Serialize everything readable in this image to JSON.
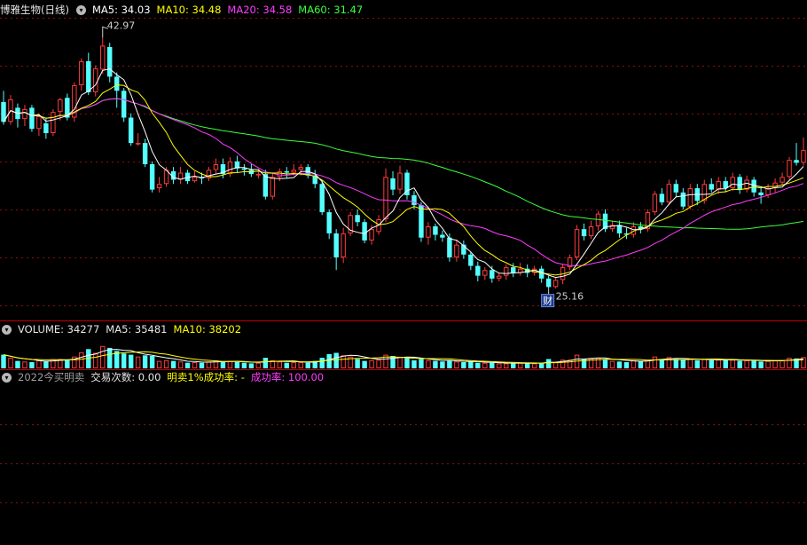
{
  "colors": {
    "background": "#000000",
    "up": "#ff3b3b",
    "down": "#54ffff",
    "ma5": "#ffffff",
    "ma10": "#ffff00",
    "ma20": "#ff3cff",
    "ma60": "#3cff3c",
    "grid": "#8a1010",
    "separator": "#c00000",
    "signal": "#ff2020",
    "header_text": "#e6e6e6",
    "header_label": "#9e9e9e"
  },
  "price_panel": {
    "stock_name": "博雅生物(日线)",
    "toggle_icon": "chevron-down-icon",
    "ma_labels": [
      {
        "key": "ma5",
        "text": "MA5: 34.03"
      },
      {
        "key": "ma10",
        "text": "MA10: 34.48"
      },
      {
        "key": "ma20",
        "text": "MA20: 34.58"
      },
      {
        "key": "ma60",
        "text": "MA60: 31.47"
      }
    ],
    "high_label": "42.97",
    "low_label": "25.16",
    "finance_badge": "财",
    "signal_marker": "$"
  },
  "volume_panel": {
    "toggle_icon": "chevron-down-icon",
    "labels": [
      {
        "key": "vol",
        "text": "VOLUME: 34277"
      },
      {
        "key": "ma5",
        "text": "MA5: 35481"
      },
      {
        "key": "ma10",
        "text": "MA10: 38202"
      }
    ]
  },
  "indicator_panel": {
    "toggle_icon": "chevron-down-icon",
    "labels": [
      {
        "key": "name",
        "text": "2022今买明卖"
      },
      {
        "key": "trades",
        "text": "交易次数: 0.00"
      },
      {
        "key": "rate1",
        "text": "明卖1%成功率: -"
      },
      {
        "key": "rate2",
        "text": "成功率: 100.00"
      }
    ]
  },
  "chart_data": {
    "type": "candlestick",
    "price_range": [
      23.5,
      44.5
    ],
    "high_value": 42.97,
    "low_value": 25.16,
    "candles": [
      [
        38.4,
        37.0,
        39.2,
        36.8
      ],
      [
        37.0,
        38.6,
        38.9,
        36.8
      ],
      [
        38.0,
        37.2,
        38.3,
        36.6
      ],
      [
        37.2,
        37.9,
        38.2,
        36.7
      ],
      [
        38.0,
        36.5,
        38.2,
        36.3
      ],
      [
        36.5,
        37.4,
        37.6,
        36.0
      ],
      [
        36.9,
        36.2,
        37.3,
        35.8
      ],
      [
        36.2,
        37.7,
        37.9,
        36.0
      ],
      [
        37.7,
        38.6,
        38.7,
        37.1
      ],
      [
        38.7,
        37.3,
        39.0,
        37.1
      ],
      [
        37.3,
        39.6,
        39.8,
        37.0
      ],
      [
        39.6,
        41.3,
        41.5,
        39.2
      ],
      [
        41.3,
        39.1,
        41.9,
        38.9
      ],
      [
        39.1,
        40.8,
        41.0,
        38.8
      ],
      [
        40.7,
        42.4,
        42.97,
        40.4
      ],
      [
        42.3,
        40.2,
        42.6,
        39.8
      ],
      [
        40.2,
        39.2,
        40.5,
        38.0
      ],
      [
        39.2,
        37.3,
        39.4,
        37.0
      ],
      [
        37.3,
        35.5,
        37.6,
        35.3
      ],
      [
        35.5,
        35.5,
        36.2,
        35.3
      ],
      [
        35.5,
        34.0,
        35.8,
        33.8
      ],
      [
        34.0,
        32.2,
        34.2,
        32.0
      ],
      [
        32.3,
        32.6,
        33.1,
        32.0
      ],
      [
        32.6,
        33.6,
        33.8,
        32.4
      ],
      [
        33.5,
        32.9,
        33.8,
        32.6
      ],
      [
        32.9,
        33.4,
        33.8,
        32.6
      ],
      [
        33.4,
        32.8,
        33.6,
        32.6
      ],
      [
        32.8,
        33.1,
        33.5,
        32.7
      ],
      [
        33.1,
        33.0,
        33.4,
        32.6
      ],
      [
        33.0,
        33.6,
        33.8,
        32.8
      ],
      [
        33.6,
        34.0,
        34.4,
        33.3
      ],
      [
        34.0,
        33.3,
        34.4,
        33.0
      ],
      [
        33.3,
        34.2,
        34.5,
        33.1
      ],
      [
        34.2,
        33.7,
        34.6,
        33.4
      ],
      [
        33.7,
        33.6,
        34.0,
        33.2
      ],
      [
        33.6,
        33.3,
        34.0,
        33.1
      ],
      [
        33.3,
        33.3,
        33.6,
        33.0
      ],
      [
        33.3,
        31.7,
        33.6,
        31.5
      ],
      [
        31.7,
        33.1,
        33.4,
        31.5
      ],
      [
        33.1,
        33.5,
        33.7,
        32.8
      ],
      [
        33.5,
        33.4,
        33.8,
        33.0
      ],
      [
        33.4,
        33.6,
        34.0,
        33.2
      ],
      [
        33.6,
        33.8,
        34.0,
        33.2
      ],
      [
        33.8,
        33.2,
        34.0,
        33.0
      ],
      [
        33.2,
        32.6,
        33.6,
        32.3
      ],
      [
        32.6,
        30.6,
        32.9,
        30.4
      ],
      [
        30.6,
        29.1,
        30.8,
        28.7
      ],
      [
        29.1,
        27.4,
        29.4,
        26.5
      ],
      [
        27.4,
        29.1,
        29.5,
        27.0
      ],
      [
        29.1,
        30.4,
        30.6,
        28.9
      ],
      [
        30.4,
        29.9,
        30.8,
        29.6
      ],
      [
        29.9,
        28.6,
        30.1,
        28.4
      ],
      [
        28.6,
        29.4,
        29.7,
        28.3
      ],
      [
        29.2,
        30.1,
        30.4,
        29.0
      ],
      [
        30.1,
        33.1,
        33.7,
        29.9
      ],
      [
        33.0,
        32.2,
        33.5,
        31.8
      ],
      [
        32.2,
        33.4,
        33.9,
        31.9
      ],
      [
        33.4,
        31.8,
        33.6,
        31.5
      ],
      [
        31.8,
        31.1,
        32.1,
        30.8
      ],
      [
        31.1,
        28.8,
        31.3,
        28.5
      ],
      [
        28.8,
        29.6,
        29.9,
        28.3
      ],
      [
        29.6,
        29.0,
        29.8,
        28.6
      ],
      [
        29.0,
        28.8,
        29.3,
        28.5
      ],
      [
        28.8,
        27.4,
        29.1,
        27.1
      ],
      [
        27.4,
        28.3,
        28.6,
        27.1
      ],
      [
        28.3,
        27.6,
        28.6,
        27.3
      ],
      [
        27.6,
        26.8,
        27.8,
        26.5
      ],
      [
        26.8,
        26.1,
        27.1,
        25.7
      ],
      [
        26.1,
        26.5,
        26.7,
        25.8
      ],
      [
        26.5,
        25.9,
        26.8,
        25.6
      ],
      [
        25.9,
        26.1,
        26.3,
        25.7
      ],
      [
        26.1,
        26.7,
        26.9,
        25.8
      ],
      [
        26.7,
        26.3,
        27.0,
        26.0
      ],
      [
        26.3,
        26.6,
        27.0,
        26.1
      ],
      [
        26.6,
        26.3,
        26.9,
        26.0
      ],
      [
        26.3,
        26.6,
        26.8,
        26.1
      ],
      [
        26.6,
        25.9,
        26.8,
        25.6
      ],
      [
        25.9,
        25.3,
        26.1,
        25.16
      ],
      [
        25.3,
        25.8,
        26.0,
        25.2
      ],
      [
        25.8,
        26.7,
        26.9,
        25.5
      ],
      [
        26.7,
        27.4,
        27.6,
        26.5
      ],
      [
        27.4,
        29.4,
        29.7,
        27.2
      ],
      [
        29.4,
        28.9,
        29.8,
        28.6
      ],
      [
        28.9,
        29.6,
        30.0,
        28.7
      ],
      [
        29.6,
        30.5,
        30.7,
        29.3
      ],
      [
        30.5,
        29.4,
        30.8,
        29.2
      ],
      [
        29.4,
        29.7,
        30.0,
        29.2
      ],
      [
        29.7,
        29.1,
        30.0,
        28.8
      ],
      [
        29.1,
        29.0,
        29.5,
        28.7
      ],
      [
        29.0,
        29.6,
        29.9,
        28.8
      ],
      [
        29.6,
        29.4,
        29.9,
        29.1
      ],
      [
        29.4,
        30.6,
        30.8,
        29.2
      ],
      [
        30.6,
        31.9,
        32.1,
        30.4
      ],
      [
        31.9,
        31.3,
        32.3,
        31.1
      ],
      [
        31.3,
        32.6,
        32.9,
        31.1
      ],
      [
        32.6,
        32.0,
        32.9,
        31.7
      ],
      [
        32.0,
        31.0,
        32.3,
        30.8
      ],
      [
        31.0,
        32.3,
        32.6,
        30.8
      ],
      [
        32.3,
        31.4,
        32.6,
        31.1
      ],
      [
        31.4,
        32.6,
        32.9,
        31.2
      ],
      [
        32.6,
        32.2,
        33.0,
        32.0
      ],
      [
        32.2,
        32.8,
        33.1,
        31.9
      ],
      [
        32.8,
        32.3,
        33.1,
        32.0
      ],
      [
        32.3,
        33.1,
        33.4,
        32.1
      ],
      [
        33.1,
        32.2,
        33.3,
        31.9
      ],
      [
        32.2,
        32.9,
        33.2,
        32.0
      ],
      [
        32.9,
        32.0,
        33.1,
        31.7
      ],
      [
        32.0,
        31.8,
        32.3,
        31.2
      ],
      [
        31.8,
        32.3,
        32.6,
        31.6
      ],
      [
        32.3,
        32.7,
        33.0,
        32.0
      ],
      [
        32.7,
        33.1,
        33.4,
        32.5
      ],
      [
        33.1,
        34.3,
        34.5,
        32.9
      ],
      [
        34.3,
        34.1,
        35.5,
        33.9
      ],
      [
        34.1,
        35.0,
        35.9,
        33.9
      ]
    ],
    "volume_range": [
      0,
      100000
    ],
    "volume": [
      44000,
      34000,
      24000,
      22000,
      20000,
      26000,
      22000,
      30000,
      30000,
      28000,
      38000,
      52000,
      62000,
      50000,
      72000,
      66000,
      56000,
      48000,
      44000,
      38000,
      42000,
      40000,
      24000,
      26000,
      24000,
      22000,
      18000,
      20000,
      18000,
      22000,
      26000,
      22000,
      24000,
      20000,
      18000,
      16000,
      18000,
      34000,
      26000,
      22000,
      18000,
      20000,
      20000,
      18000,
      24000,
      34000,
      46000,
      50000,
      42000,
      38000,
      30000,
      24000,
      26000,
      28000,
      44000,
      40000,
      36000,
      34000,
      26000,
      30000,
      26000,
      24000,
      22000,
      26000,
      22000,
      20000,
      22000,
      18000,
      18000,
      18000,
      16000,
      16000,
      16000,
      18000,
      16000,
      16000,
      18000,
      30000,
      20000,
      28000,
      28000,
      44000,
      30000,
      32000,
      34000,
      28000,
      24000,
      22000,
      20000,
      26000,
      22000,
      28000,
      38000,
      30000,
      36000,
      30000,
      28000,
      30000,
      26000,
      30000,
      26000,
      28000,
      26000,
      28000,
      24000,
      26000,
      24000,
      22000,
      24000,
      26000,
      26000,
      34000,
      32000,
      36000
    ],
    "indicator_signal_index": 117
  }
}
